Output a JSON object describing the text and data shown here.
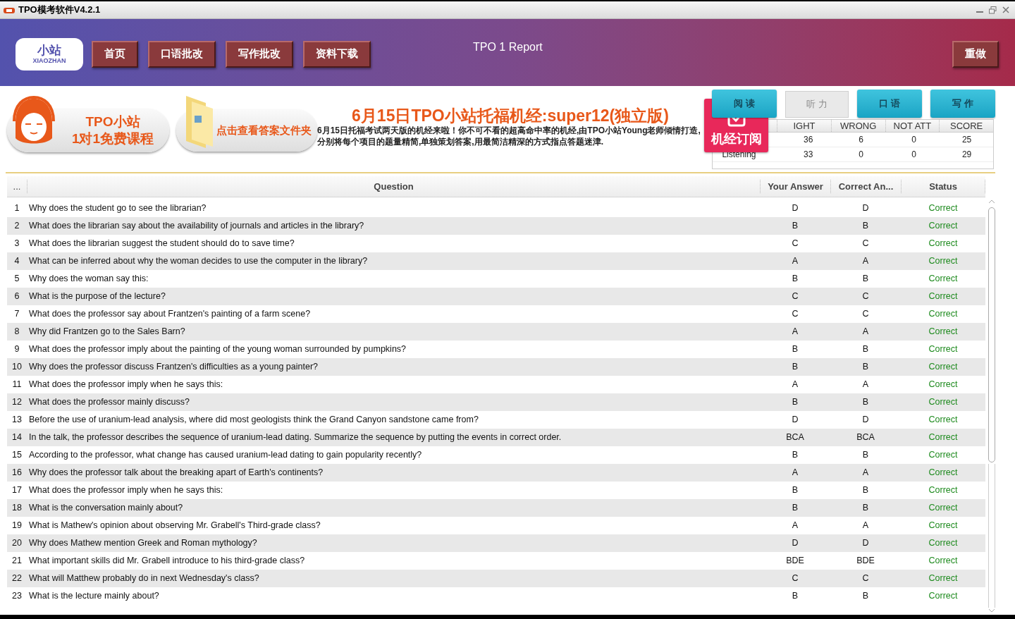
{
  "window": {
    "title": "TPO模考软件V4.2.1"
  },
  "header": {
    "logo_text": "小站",
    "logo_subtext": "XIAOZHAN",
    "nav": [
      "首页",
      "口语批改",
      "写作批改",
      "资料下载"
    ],
    "report_title": "TPO 1 Report",
    "redo_button": "重做"
  },
  "promos": [
    {
      "line1": "TPO小站",
      "line2": "1对1免费课程"
    },
    {
      "line1": "点击查看答案文件夹"
    }
  ],
  "news": {
    "headline": "6月15日TPO小站托福机经:super12(独立版)",
    "body": "6月15日托福考试两天版的机经来啦！你不可不看的超高命中率的机经,由TPO小站Young老师倾情打造,分别将每个项目的题量精简,单独策划答案,用最简洁精深的方式指点答题迷津."
  },
  "subscribe_badge": "机经订阅",
  "section_tabs": [
    {
      "label": "阅 读",
      "selected": false
    },
    {
      "label": "听 力",
      "selected": true
    },
    {
      "label": "口 语",
      "selected": false
    },
    {
      "label": "写 作",
      "selected": false
    }
  ],
  "score_table": {
    "columns": [
      "IGHT",
      "WRONG",
      "NOT ATT",
      "SCORE"
    ],
    "rows": [
      {
        "label": "",
        "values": [
          "36",
          "6",
          "0",
          "25"
        ]
      },
      {
        "label": "Listening",
        "values": [
          "33",
          "0",
          "0",
          "29"
        ]
      }
    ]
  },
  "question_table": {
    "columns": [
      "...",
      "Question",
      "Your Answer",
      "Correct An...",
      "Status"
    ],
    "rows": [
      {
        "number": "1",
        "question": "Why does the student go to see the librarian?",
        "your_answer": "D",
        "correct_answer": "D",
        "status": "Correct",
        "correct": true
      },
      {
        "number": "2",
        "question": "What does the librarian say about the availability of journals and articles in the library?",
        "your_answer": "B",
        "correct_answer": "B",
        "status": "Correct",
        "correct": true
      },
      {
        "number": "3",
        "question": "What does the librarian suggest the student should do to save time?",
        "your_answer": "C",
        "correct_answer": "C",
        "status": "Correct",
        "correct": true
      },
      {
        "number": "4",
        "question": "What can be inferred about why the woman decides to use the computer in the library?",
        "your_answer": "A",
        "correct_answer": "A",
        "status": "Correct",
        "correct": true
      },
      {
        "number": "5",
        "question": "Why does the woman say this:",
        "your_answer": "B",
        "correct_answer": "B",
        "status": "Correct",
        "correct": true
      },
      {
        "number": "6",
        "question": "What is the purpose of the lecture?",
        "your_answer": "C",
        "correct_answer": "C",
        "status": "Correct",
        "correct": true
      },
      {
        "number": "7",
        "question": "What does the professor say about Frantzen's painting of a farm scene?",
        "your_answer": "C",
        "correct_answer": "C",
        "status": "Correct",
        "correct": true
      },
      {
        "number": "8",
        "question": "Why did Frantzen go to the Sales Barn?",
        "your_answer": "A",
        "correct_answer": "A",
        "status": "Correct",
        "correct": true
      },
      {
        "number": "9",
        "question": "What does the professor imply about the painting of the young woman surrounded by pumpkins?",
        "your_answer": "B",
        "correct_answer": "B",
        "status": "Correct",
        "correct": true
      },
      {
        "number": "10",
        "question": "Why does the professor discuss Frantzen's difficulties as a young painter?",
        "your_answer": "B",
        "correct_answer": "B",
        "status": "Correct",
        "correct": true
      },
      {
        "number": "11",
        "question": "What does the professor imply when he says this:",
        "your_answer": "A",
        "correct_answer": "A",
        "status": "Correct",
        "correct": true
      },
      {
        "number": "12",
        "question": "What does the professor mainly discuss?",
        "your_answer": "B",
        "correct_answer": "B",
        "status": "Correct",
        "correct": true
      },
      {
        "number": "13",
        "question": "Before the use of uranium-lead analysis, where did most geologists think the Grand Canyon sandstone came from?",
        "your_answer": "D",
        "correct_answer": "D",
        "status": "Correct",
        "correct": true
      },
      {
        "number": "14",
        "question": "In the talk, the professor describes the sequence of uranium-lead dating. Summarize the sequence by putting the events in correct order.",
        "your_answer": "BCA",
        "correct_answer": "BCA",
        "status": "Correct",
        "correct": true
      },
      {
        "number": "15",
        "question": "According to the professor, what change has caused uranium-lead dating to gain popularity recently?",
        "your_answer": "B",
        "correct_answer": "B",
        "status": "Correct",
        "correct": true
      },
      {
        "number": "16",
        "question": "Why does the professor talk about the breaking apart of Earth's continents?",
        "your_answer": "A",
        "correct_answer": "A",
        "status": "Correct",
        "correct": true
      },
      {
        "number": "17",
        "question": "What does the professor imply when he says this:",
        "your_answer": "B",
        "correct_answer": "B",
        "status": "Correct",
        "correct": true
      },
      {
        "number": "18",
        "question": "What is the conversation mainly about?",
        "your_answer": "B",
        "correct_answer": "B",
        "status": "Correct",
        "correct": true
      },
      {
        "number": "19",
        "question": "What is Mathew's opinion about observing Mr. Grabell's Third-grade class?",
        "your_answer": "A",
        "correct_answer": "A",
        "status": "Correct",
        "correct": true
      },
      {
        "number": "20",
        "question": "Why does Mathew mention Greek and Roman mythology?",
        "your_answer": "D",
        "correct_answer": "D",
        "status": "Correct",
        "correct": true
      },
      {
        "number": "21",
        "question": "What important skills did Mr. Grabell introduce to his third-grade class?",
        "your_answer": "BDE",
        "correct_answer": "BDE",
        "status": "Correct",
        "correct": true
      },
      {
        "number": "22",
        "question": "What will Matthew probably do in next Wednesday's class?",
        "your_answer": "C",
        "correct_answer": "C",
        "status": "Correct",
        "correct": true
      },
      {
        "number": "23",
        "question": "What is the lecture mainly about?",
        "your_answer": "B",
        "correct_answer": "B",
        "status": "Correct",
        "correct": true
      }
    ]
  }
}
